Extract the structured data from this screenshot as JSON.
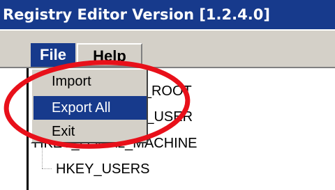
{
  "window": {
    "title": "Registry Editor Version [1.2.4.0]"
  },
  "menubar": {
    "file_label": "File",
    "help_label": "Help"
  },
  "file_menu": {
    "items": [
      {
        "label": "Import",
        "selected": false
      },
      {
        "label": "Export All",
        "selected": true
      },
      {
        "label": "Exit",
        "selected": false
      }
    ]
  },
  "tree": {
    "items": [
      {
        "label": "HKEY_CLASSES_ROOT"
      },
      {
        "label": "HKEY_CURRENT_USER"
      },
      {
        "label": "HKEY_LOCAL_MACHINE"
      },
      {
        "label": "HKEY_USERS"
      }
    ]
  },
  "colors": {
    "title_bg": "#173a8c",
    "menu_bg": "#d4d0c8",
    "annotation_red": "#e8101a"
  }
}
